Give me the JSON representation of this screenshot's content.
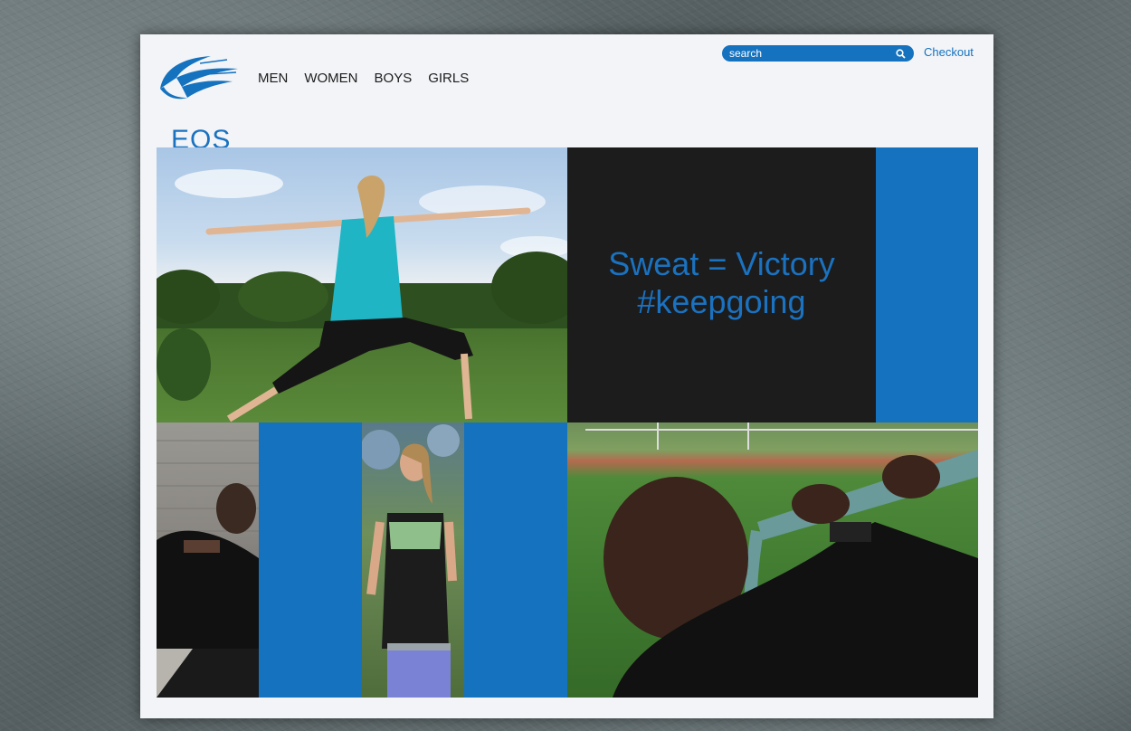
{
  "brand": {
    "logo_text": "EOS",
    "accent_color": "#1572bf"
  },
  "nav": {
    "items": [
      "MEN",
      "WOMEN",
      "BOYS",
      "GIRLS"
    ]
  },
  "search": {
    "placeholder": "search",
    "icon": "search-icon"
  },
  "checkout": {
    "label": "Checkout"
  },
  "hero": {
    "quote_line1": "Sweat = Victory",
    "quote_line2": "#keepgoing"
  }
}
